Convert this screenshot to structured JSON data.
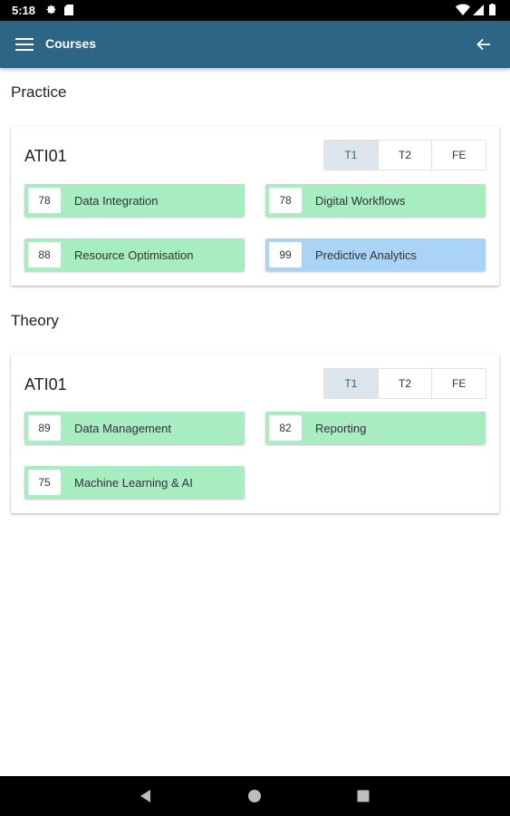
{
  "status_bar": {
    "time": "5:18",
    "icons": [
      "gear-icon",
      "sd-card-icon",
      "wifi-icon",
      "cell-signal-icon",
      "battery-icon"
    ]
  },
  "app_bar": {
    "title": "Courses",
    "menu_icon": "menu-icon",
    "back_icon": "arrow-left-icon",
    "color": "#2d6585"
  },
  "colors": {
    "green": "#a8ecc2",
    "blue": "#a9d4f6",
    "toggle_active": "#dde5ec"
  },
  "practice": {
    "title": "Practice",
    "card_title": "ATI01",
    "tabs": [
      "T1",
      "T2",
      "FE"
    ],
    "active_tab": "T1",
    "courses": [
      {
        "score": "78",
        "name": "Data Integration",
        "color": "green"
      },
      {
        "score": "78",
        "name": "Digital Workflows",
        "color": "green"
      },
      {
        "score": "88",
        "name": "Resource Optimisation",
        "color": "green"
      },
      {
        "score": "99",
        "name": "Predictive Analytics",
        "color": "blue"
      }
    ]
  },
  "theory": {
    "title": "Theory",
    "card_title": "ATI01",
    "tabs": [
      "T1",
      "T2",
      "FE"
    ],
    "active_tab": "T1",
    "courses": [
      {
        "score": "89",
        "name": "Data Management",
        "color": "green"
      },
      {
        "score": "82",
        "name": "Reporting",
        "color": "green"
      },
      {
        "score": "75",
        "name": "Machine Learning & AI",
        "color": "green"
      }
    ]
  },
  "nav_bar": {
    "icons": [
      "back-triangle-icon",
      "home-circle-icon",
      "recents-square-icon"
    ]
  }
}
